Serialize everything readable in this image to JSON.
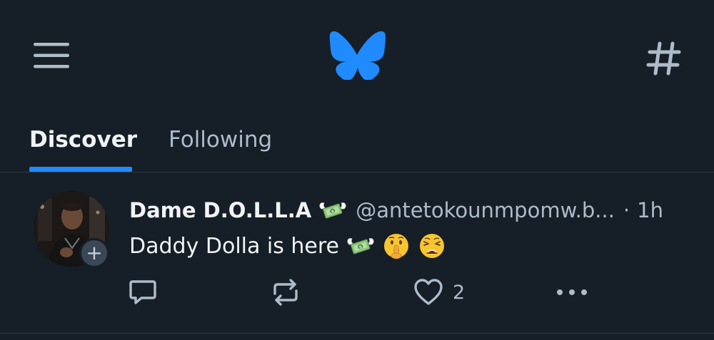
{
  "icons": {
    "menu": "hamburger-menu-icon",
    "logo": "butterfly-logo",
    "feeds": "hashtag-icon",
    "reply": "speech-bubble-icon",
    "repost": "repost-arrows-icon",
    "like": "heart-icon",
    "more": "more-dots-icon"
  },
  "colors": {
    "background": "#161e27",
    "accent": "#208bfe",
    "muted_text": "#aebbc9",
    "primary_text": "#f1f3f5"
  },
  "tabs": [
    {
      "label": "Discover",
      "active": true
    },
    {
      "label": "Following",
      "active": false
    }
  ],
  "post": {
    "display_name": "Dame D.O.L.L.A",
    "handle": "@antetokounmpomw.b...",
    "separator": "·",
    "time": "1h",
    "text": "Daddy Dolla is here",
    "follow_badge": "+",
    "like_count": "2"
  }
}
